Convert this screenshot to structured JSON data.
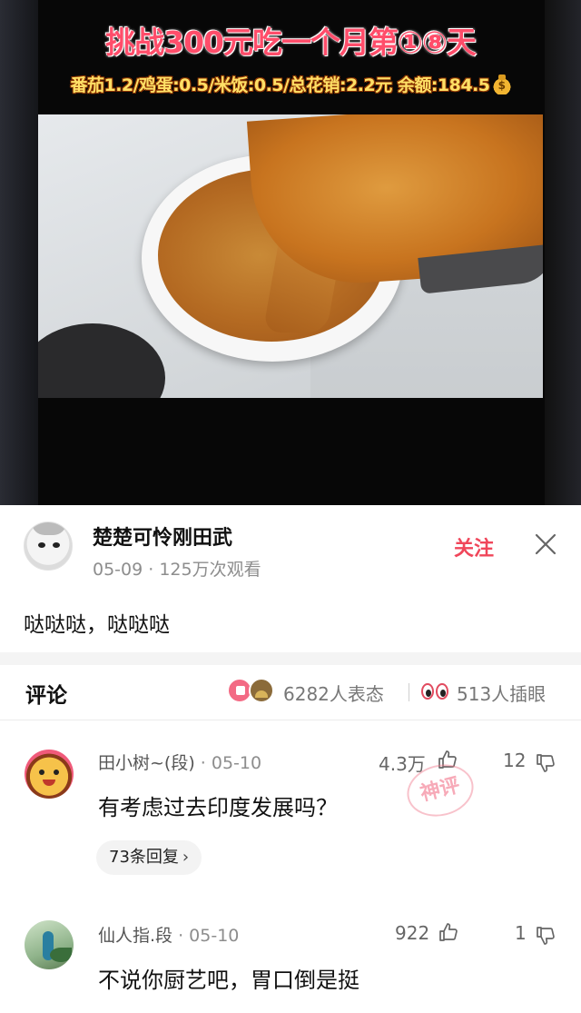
{
  "video": {
    "title": "挑战300元吃一个月第①⑧天",
    "costs": "番茄1.2/鸡蛋:0.5/米饭:0.5/总花销:2.2元  余额:184.5",
    "icon": "money-bag-icon"
  },
  "post": {
    "author": "楚楚可怜刚田武",
    "meta": "05-09 · 125万次观看",
    "follow_label": "关注",
    "text": "哒哒哒，哒哒哒"
  },
  "comments_bar": {
    "title": "评论",
    "reaction_count": "6282人表态",
    "eyes_count": "513人插眼"
  },
  "comments": [
    {
      "user": "田小树~(段)",
      "date": "· 05-10",
      "likes": "4.3万",
      "dislikes": "12",
      "text": "有考虑过去印度发展吗？",
      "replies": "73条回复",
      "stamp": "神评"
    },
    {
      "user": "仙人指.段",
      "date": "· 05-10",
      "likes": "922",
      "dislikes": "1",
      "text": "不说你厨艺吧，胃口倒是挺"
    }
  ],
  "colors": {
    "accent": "#f0465a",
    "title_caption": "#ff4d6a",
    "cost_caption": "#ffe066"
  }
}
